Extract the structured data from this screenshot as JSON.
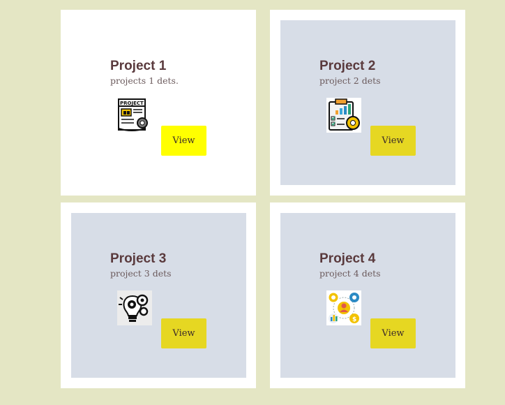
{
  "colors": {
    "page_background": "#e4e6c4",
    "card_background": "#ffffff",
    "panel_tint": "#d7dde7",
    "button_bright_yellow": "#ffff00",
    "button_mustard": "#e6d722",
    "title_color": "#5a3a3d"
  },
  "projects": [
    {
      "title": "Project 1",
      "description": "projects 1 dets.",
      "button_label": "View",
      "icon": "project-document-gear-icon"
    },
    {
      "title": "Project 2",
      "description": "project 2 dets",
      "button_label": "View",
      "icon": "clipboard-chart-gear-icon"
    },
    {
      "title": "Project 3",
      "description": "project 3 dets",
      "button_label": "View",
      "icon": "lightbulb-gears-icon"
    },
    {
      "title": "Project 4",
      "description": "project 4 dets",
      "button_label": "View",
      "icon": "team-network-icon"
    }
  ]
}
